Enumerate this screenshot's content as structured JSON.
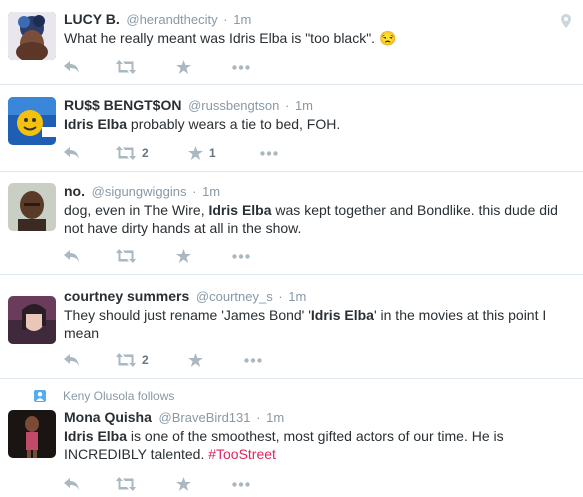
{
  "tweets": [
    {
      "fullname": "LUCY B.",
      "username": "@herandthecity",
      "time": "1m",
      "text_parts": [
        "What he really meant was Idris Elba is \"too black\". ",
        "😒"
      ],
      "retweets": "",
      "favorites": ""
    },
    {
      "fullname": "RU$$ BENGT$ON",
      "username": "@russbengtson",
      "time": "1m",
      "bold": "Idris Elba",
      "text_after": " probably wears a tie to bed, FOH.",
      "retweets": "2",
      "favorites": "1"
    },
    {
      "fullname": "no.",
      "username": "@sigungwiggins",
      "time": "1m",
      "text_before": "dog, even in The Wire, ",
      "bold": "Idris Elba",
      "text_after": " was kept together and Bondlike. this dude did not have dirty hands at all in the show.",
      "retweets": "",
      "favorites": ""
    },
    {
      "fullname": "courtney summers",
      "username": "@courtney_s",
      "time": "1m",
      "text_before": "They should just rename 'James Bond' '",
      "bold": "Idris Elba",
      "text_after": "' in the movies at this point I mean",
      "retweets": "2",
      "favorites": ""
    },
    {
      "context": "Keny Olusola follows",
      "fullname": "Mona Quisha",
      "username": "@BraveBird131",
      "time": "1m",
      "bold": "Idris Elba",
      "text_after": " is one of the smoothest, most gifted actors of our time. He is INCREDIBLY talented. ",
      "hashtag": "#TooStreet",
      "retweets": "",
      "favorites": ""
    }
  ],
  "separator": "·",
  "icons": {
    "reply": "reply-icon",
    "retweet": "retweet-icon",
    "favorite": "star-icon",
    "more": "more-icon",
    "location": "location-pin-icon",
    "follow": "person-icon"
  },
  "colors": {
    "text": "#292f33",
    "secondary": "#8899a6",
    "action": "#aab8c2",
    "hashtag": "#e0245e",
    "divider": "#e1e8ed"
  }
}
